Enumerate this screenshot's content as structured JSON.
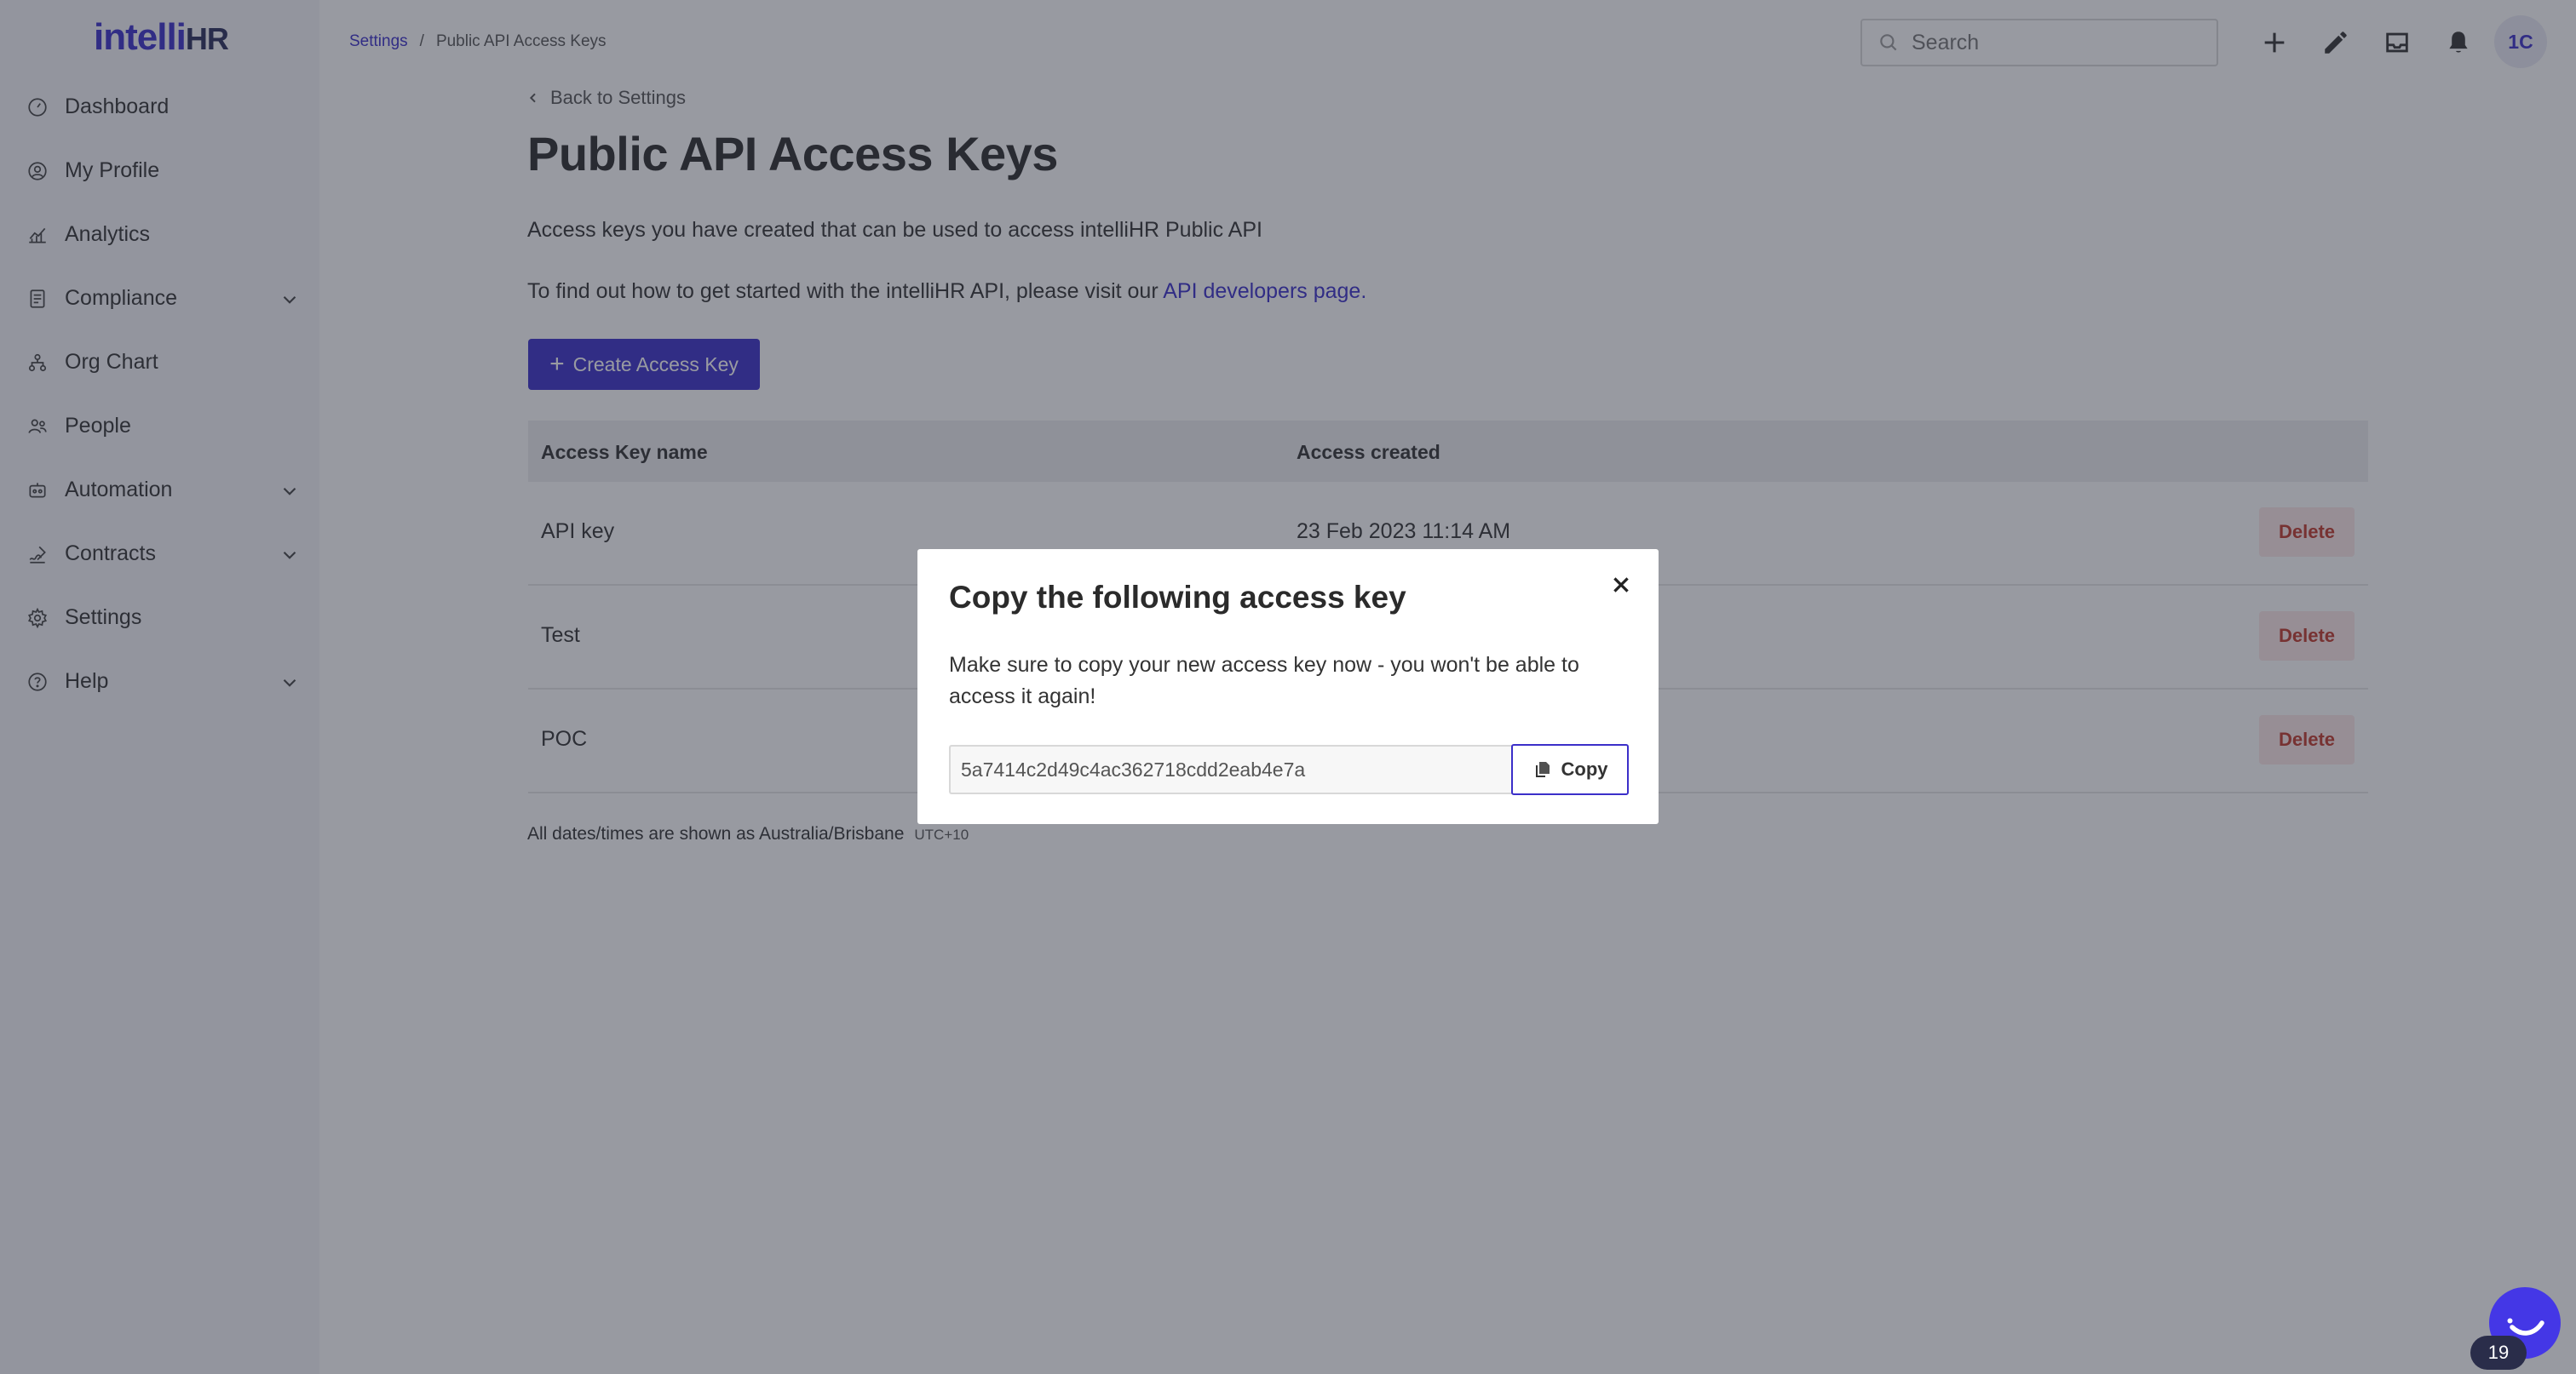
{
  "app": {
    "logo_main": "intelli",
    "logo_accent": "HR"
  },
  "sidebar": {
    "items": [
      {
        "label": "Dashboard",
        "icon": "dashboard-icon",
        "has_chevron": false
      },
      {
        "label": "My Profile",
        "icon": "profile-icon",
        "has_chevron": false
      },
      {
        "label": "Analytics",
        "icon": "analytics-icon",
        "has_chevron": false
      },
      {
        "label": "Compliance",
        "icon": "compliance-icon",
        "has_chevron": true
      },
      {
        "label": "Org Chart",
        "icon": "org-chart-icon",
        "has_chevron": false
      },
      {
        "label": "People",
        "icon": "people-icon",
        "has_chevron": false
      },
      {
        "label": "Automation",
        "icon": "automation-icon",
        "has_chevron": true
      },
      {
        "label": "Contracts",
        "icon": "contracts-icon",
        "has_chevron": true
      },
      {
        "label": "Settings",
        "icon": "settings-icon",
        "has_chevron": false
      },
      {
        "label": "Help",
        "icon": "help-icon",
        "has_chevron": true
      }
    ]
  },
  "header": {
    "breadcrumb": {
      "parent": "Settings",
      "separator": "/",
      "current": "Public API Access Keys"
    },
    "search": {
      "placeholder": "Search",
      "value": ""
    },
    "icons": [
      "plus-icon",
      "pencil-icon",
      "inbox-icon",
      "bell-icon"
    ],
    "avatar_initials": "1C"
  },
  "main": {
    "back_label": "Back to Settings",
    "title": "Public API Access Keys",
    "description": "Access keys you have created that can be used to access intelliHR Public API",
    "help_text_prefix": "To find out how to get started with the intelliHR API, please visit our ",
    "help_link": "API developers page.",
    "create_button": "Create Access Key",
    "table": {
      "columns": [
        "Access Key name",
        "Access created"
      ],
      "rows": [
        {
          "name": "API key",
          "created": "23 Feb 2023 11:14 AM",
          "action": "Delete"
        },
        {
          "name": "Test",
          "created": "",
          "action": "Delete"
        },
        {
          "name": "POC",
          "created": "",
          "action": "Delete"
        }
      ]
    },
    "timezone_note": "All dates/times are shown as Australia/Brisbane",
    "timezone_offset": "UTC+10"
  },
  "modal": {
    "title": "Copy the following access key",
    "message": "Make sure to copy your new access key now - you won't be able to access it again!",
    "access_key": "5a7414c2d49c4ac362718cdd2eab4e7a",
    "copy_label": "Copy"
  },
  "chat": {
    "badge_count": "19"
  },
  "colors": {
    "brand": "#3b2fc9",
    "danger": "#c0392b",
    "danger_bg": "#fde8e8",
    "sidebar_bg": "#f5f6fa",
    "overlay": "rgba(40,44,58,0.48)"
  }
}
